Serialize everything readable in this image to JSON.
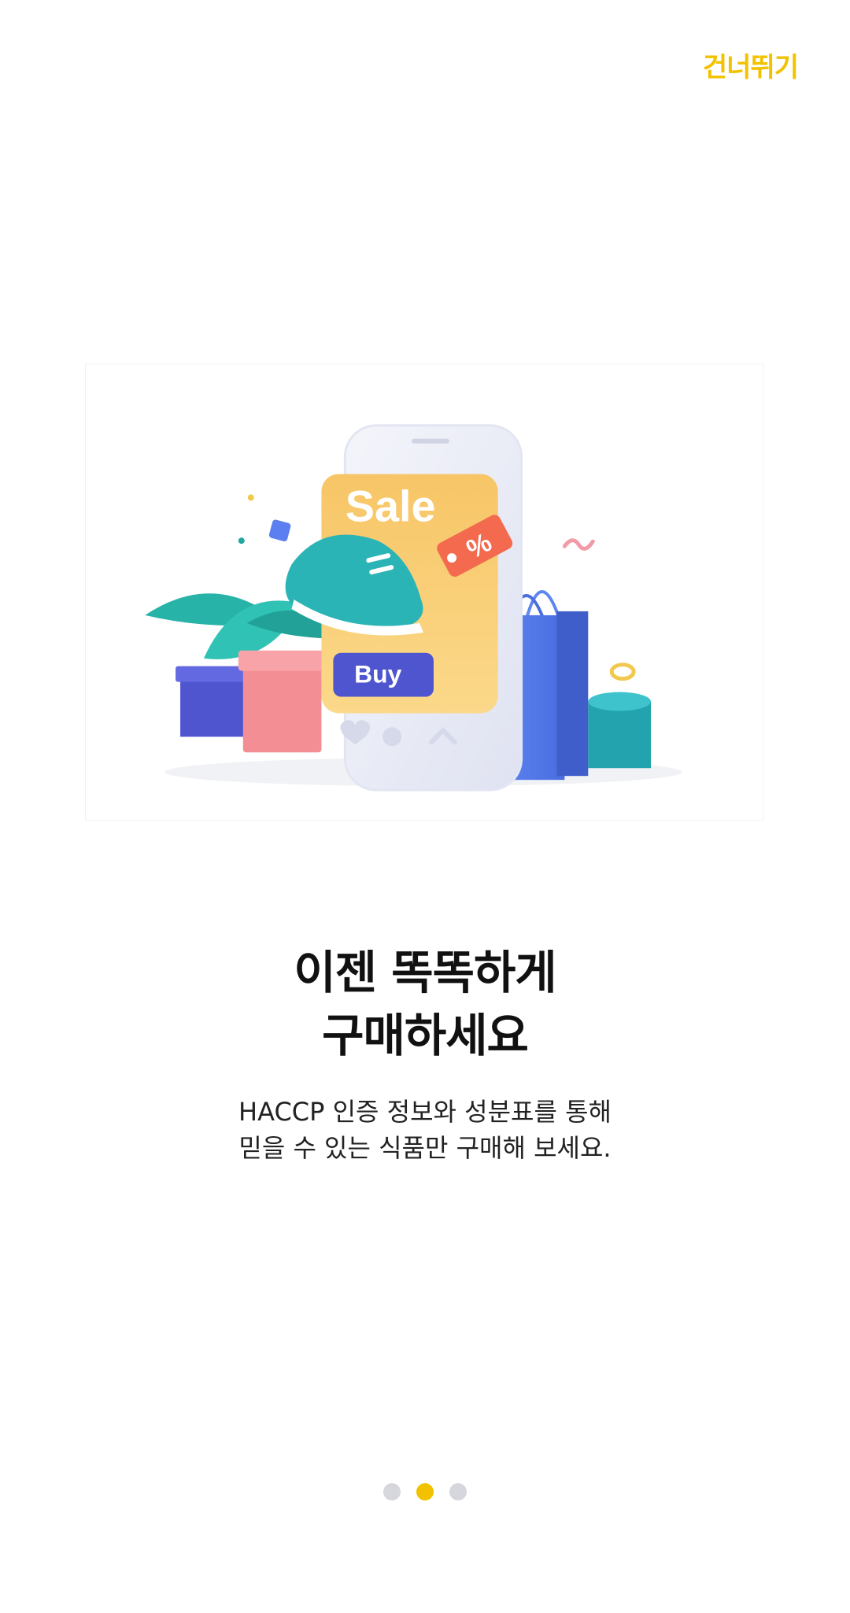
{
  "header": {
    "skip_label": "건너뛰기"
  },
  "illustration": {
    "sale_text": "Sale",
    "buy_text": "Buy",
    "tag_text": "%"
  },
  "content": {
    "headline_line1": "이젠 똑똑하게",
    "headline_line2": "구매하세요",
    "description_line1": "HACCP 인증 정보와 성분표를 통해",
    "description_line2": "믿을 수 있는 식품만 구매해 보세요."
  },
  "pager": {
    "total": 3,
    "current": 2
  },
  "colors": {
    "accent": "#f2c200",
    "dot_inactive": "#d5d7dd",
    "text_primary": "#111111"
  }
}
